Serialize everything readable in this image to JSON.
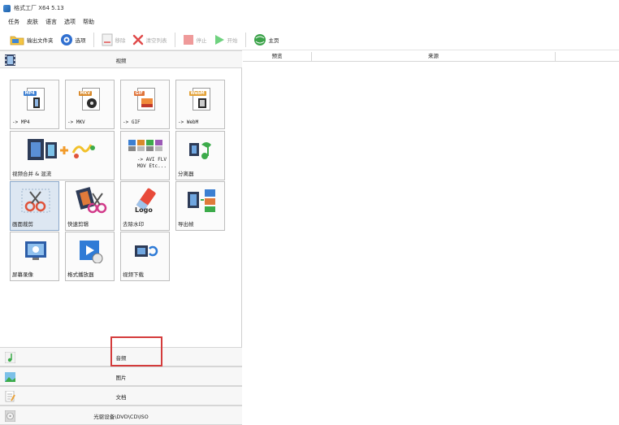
{
  "window": {
    "title": "格式工厂 X64 5.13"
  },
  "menu": [
    "任务",
    "皮肤",
    "语言",
    "选项",
    "帮助"
  ],
  "toolbar": {
    "output_folder": "输出文件夹",
    "options": "选项",
    "remove": "移除",
    "clear_list": "清空列表",
    "stop": "停止",
    "start": "开始",
    "home": "主页"
  },
  "categories": {
    "video": "视频",
    "audio": "音频",
    "image": "图片",
    "document": "文档",
    "optical": "光驱设备\\DVD\\CD\\ISO"
  },
  "tiles": [
    {
      "id": "mp4",
      "badge": "MP4",
      "label": "-> MP4"
    },
    {
      "id": "mkv",
      "badge": "MKV",
      "label": "-> MKV"
    },
    {
      "id": "gif",
      "badge": "GIF",
      "label": "-> GIF"
    },
    {
      "id": "webm",
      "badge": "WebM",
      "label": "-> WebM"
    },
    {
      "id": "merge",
      "label": "视频合并 & 混流"
    },
    {
      "id": "avi",
      "label": "-> AVI FLV\nMOV Etc..."
    },
    {
      "id": "splitter",
      "label": "分离器"
    },
    {
      "id": "crop",
      "label": "画面裁剪"
    },
    {
      "id": "quickclip",
      "label": "快速剪辑"
    },
    {
      "id": "watermark",
      "label": "去除水印",
      "art_text": "Logo"
    },
    {
      "id": "export_frames",
      "label": "导出帧"
    },
    {
      "id": "screen_record",
      "label": "屏幕录像"
    },
    {
      "id": "player",
      "label": "格式播放器"
    },
    {
      "id": "download",
      "label": "视频下载"
    }
  ],
  "table": {
    "columns": [
      "预览",
      "来源"
    ]
  },
  "colors": {
    "highlight": "#d43b3b",
    "selected_tile": "#dde7f2",
    "start_green": "#2fb34a",
    "stop_red": "#e0484a"
  }
}
